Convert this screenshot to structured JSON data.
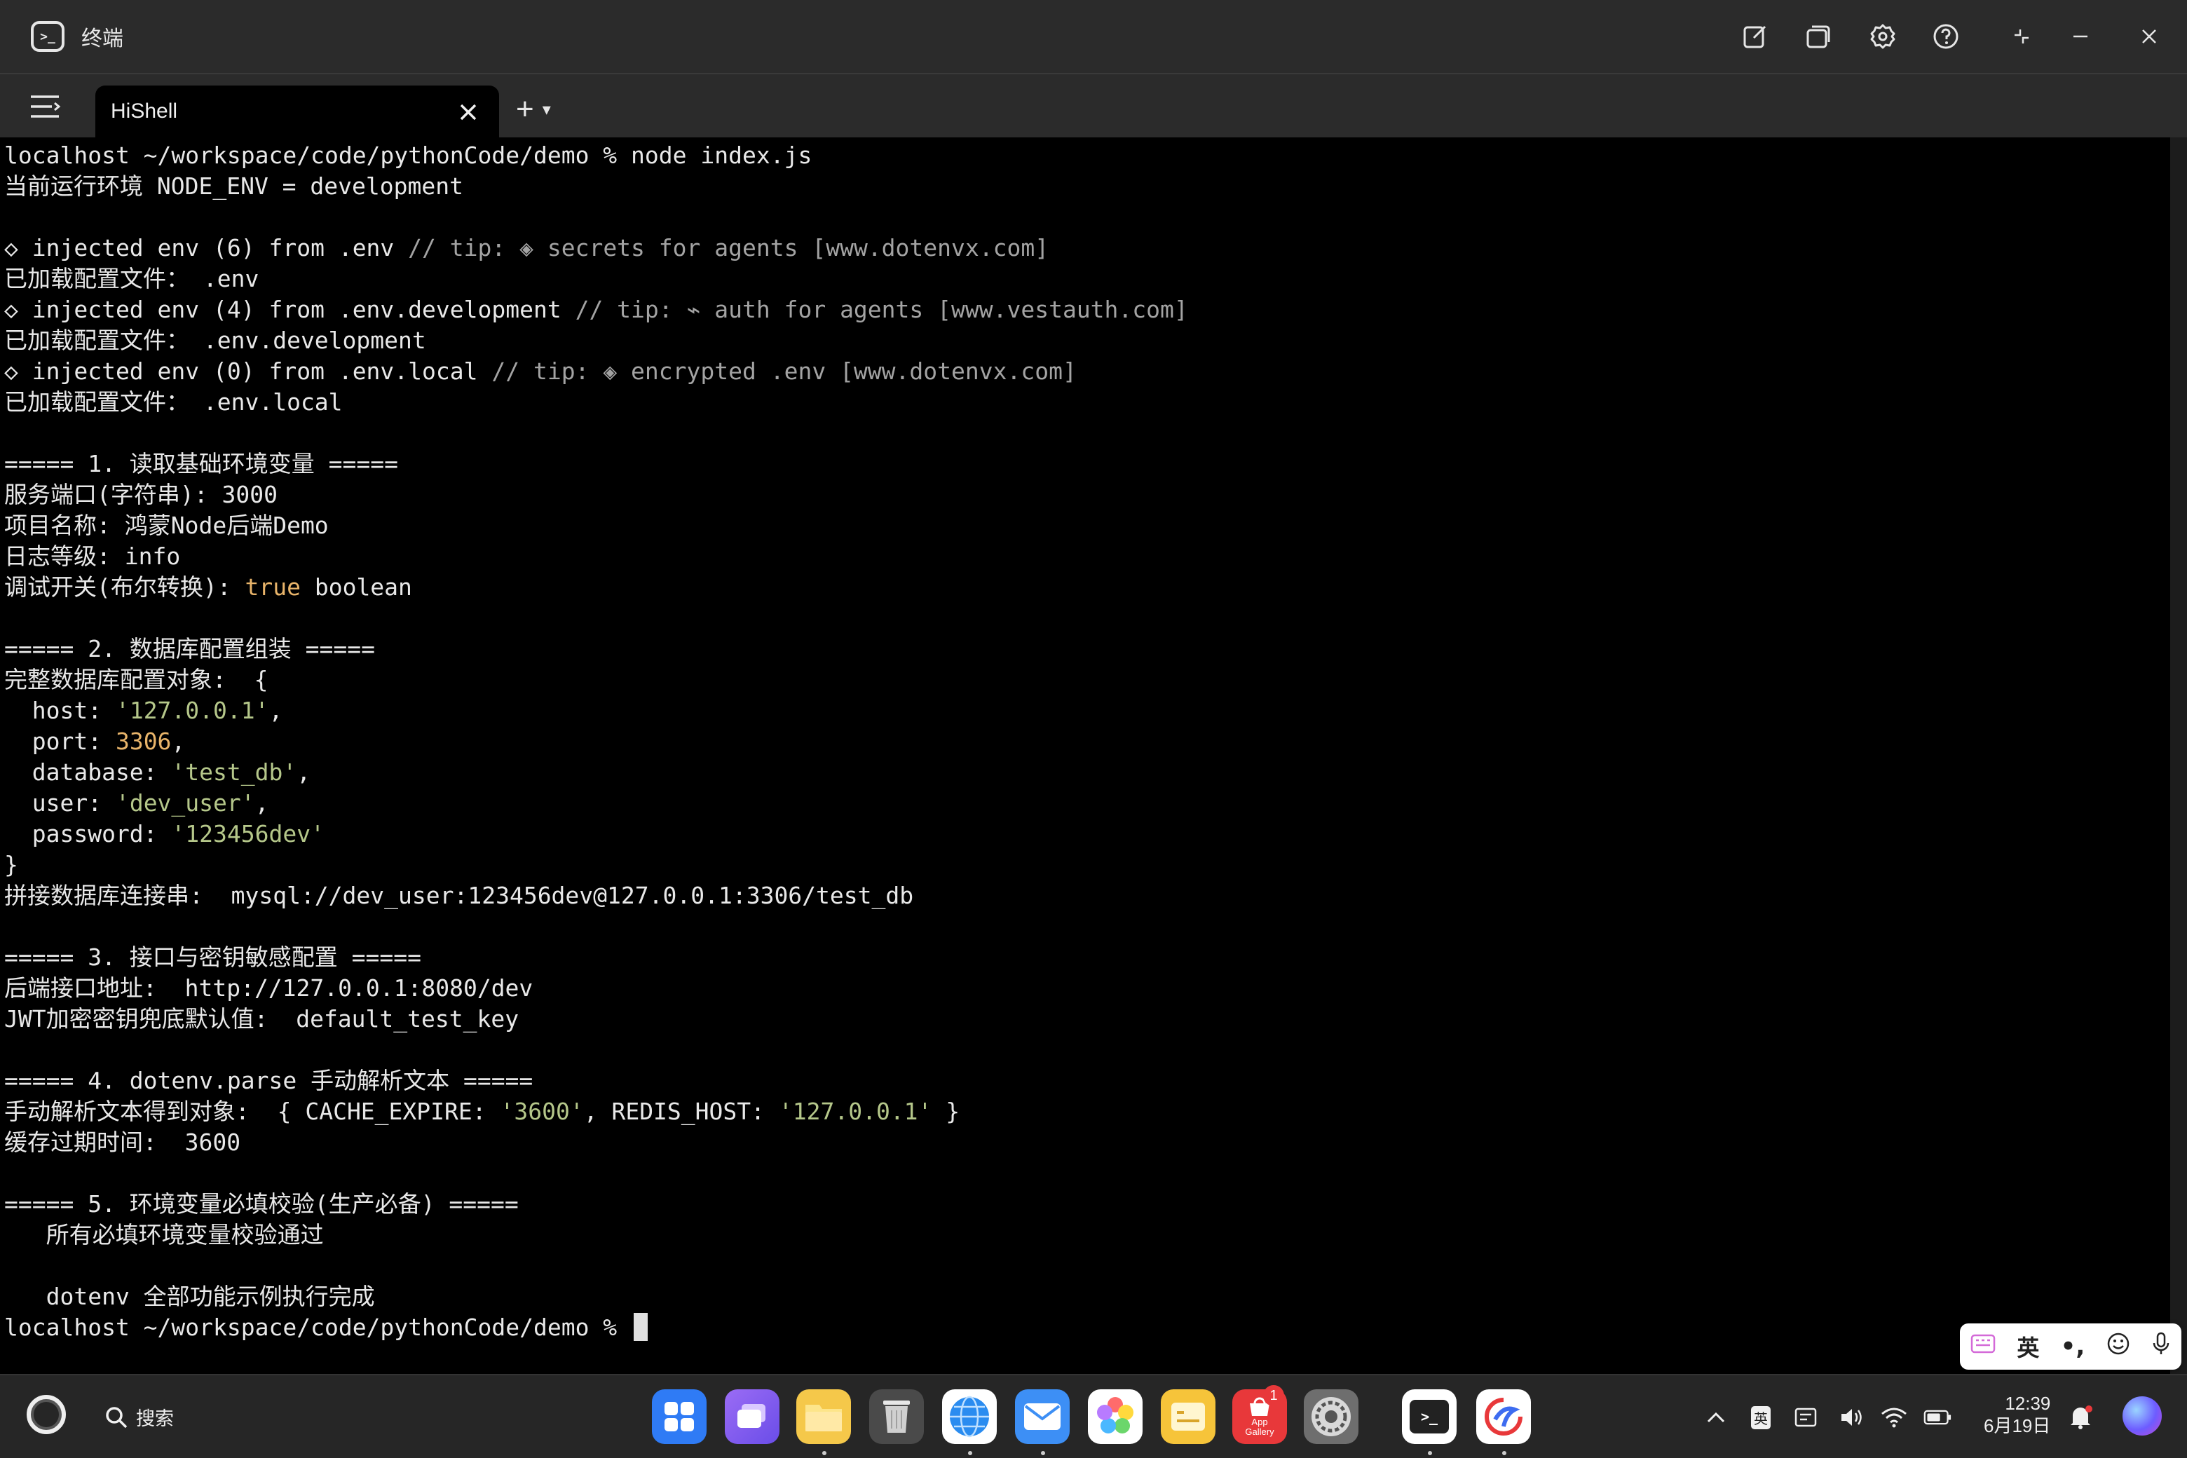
{
  "window": {
    "title": "终端",
    "controls": [
      "new-window",
      "multi-window",
      "settings",
      "help",
      "restore",
      "minimize",
      "close"
    ]
  },
  "tabbar": {
    "active_tab": "HiShell",
    "new_tab": "+",
    "new_tab_menu": "▾"
  },
  "colors": {
    "background": "#000000",
    "text": "#e8e8e8",
    "comment": "#a3a3a3",
    "string": "#b5c78a",
    "number": "#e8b46a",
    "chrome": "#2b2b2b"
  },
  "terminal": {
    "lines": [
      {
        "segments": [
          {
            "t": "localhost ~/workspace/code/pythonCode/demo % node index.js",
            "c": ""
          }
        ]
      },
      {
        "segments": [
          {
            "t": "当前运行环境 NODE_ENV = development",
            "c": ""
          }
        ]
      },
      {
        "segments": []
      },
      {
        "segments": [
          {
            "t": "◇ injected env (6) from .env ",
            "c": ""
          },
          {
            "t": "// tip: ◈ secrets for agents [www.dotenvx.com]",
            "c": "gray"
          }
        ]
      },
      {
        "segments": [
          {
            "t": "已加载配置文件： .env",
            "c": ""
          }
        ]
      },
      {
        "segments": [
          {
            "t": "◇ injected env (4) from .env.development ",
            "c": ""
          },
          {
            "t": "// tip: ⌁ auth for agents [www.vestauth.com]",
            "c": "gray"
          }
        ]
      },
      {
        "segments": [
          {
            "t": "已加载配置文件： .env.development",
            "c": ""
          }
        ]
      },
      {
        "segments": [
          {
            "t": "◇ injected env (0) from .env.local ",
            "c": ""
          },
          {
            "t": "// tip: ◈ encrypted .env [www.dotenvx.com]",
            "c": "gray"
          }
        ]
      },
      {
        "segments": [
          {
            "t": "已加载配置文件： .env.local",
            "c": ""
          }
        ]
      },
      {
        "segments": []
      },
      {
        "segments": [
          {
            "t": "===== 1. 读取基础环境变量 =====",
            "c": ""
          }
        ]
      },
      {
        "segments": [
          {
            "t": "服务端口(字符串): 3000",
            "c": ""
          }
        ]
      },
      {
        "segments": [
          {
            "t": "项目名称: 鸿蒙Node后端Demo",
            "c": ""
          }
        ]
      },
      {
        "segments": [
          {
            "t": "日志等级: info",
            "c": ""
          }
        ]
      },
      {
        "segments": [
          {
            "t": "调试开关(布尔转换): ",
            "c": ""
          },
          {
            "t": "true",
            "c": "orange"
          },
          {
            "t": " boolean",
            "c": ""
          }
        ]
      },
      {
        "segments": []
      },
      {
        "segments": [
          {
            "t": "===== 2. 数据库配置组装 =====",
            "c": ""
          }
        ]
      },
      {
        "segments": [
          {
            "t": "完整数据库配置对象:  {",
            "c": ""
          }
        ]
      },
      {
        "segments": [
          {
            "t": "  host: ",
            "c": ""
          },
          {
            "t": "'127.0.0.1'",
            "c": "green"
          },
          {
            "t": ",",
            "c": ""
          }
        ]
      },
      {
        "segments": [
          {
            "t": "  port: ",
            "c": ""
          },
          {
            "t": "3306",
            "c": "orange"
          },
          {
            "t": ",",
            "c": ""
          }
        ]
      },
      {
        "segments": [
          {
            "t": "  database: ",
            "c": ""
          },
          {
            "t": "'test_db'",
            "c": "green"
          },
          {
            "t": ",",
            "c": ""
          }
        ]
      },
      {
        "segments": [
          {
            "t": "  user: ",
            "c": ""
          },
          {
            "t": "'dev_user'",
            "c": "green"
          },
          {
            "t": ",",
            "c": ""
          }
        ]
      },
      {
        "segments": [
          {
            "t": "  password: ",
            "c": ""
          },
          {
            "t": "'123456dev'",
            "c": "green"
          }
        ]
      },
      {
        "segments": [
          {
            "t": "}",
            "c": ""
          }
        ]
      },
      {
        "segments": [
          {
            "t": "拼接数据库连接串:  mysql://dev_user:123456dev@127.0.0.1:3306/test_db",
            "c": ""
          }
        ]
      },
      {
        "segments": []
      },
      {
        "segments": [
          {
            "t": "===== 3. 接口与密钥敏感配置 =====",
            "c": ""
          }
        ]
      },
      {
        "segments": [
          {
            "t": "后端接口地址:  http://127.0.0.1:8080/dev",
            "c": ""
          }
        ]
      },
      {
        "segments": [
          {
            "t": "JWT加密密钥兜底默认值:  default_test_key",
            "c": ""
          }
        ]
      },
      {
        "segments": []
      },
      {
        "segments": [
          {
            "t": "===== 4. dotenv.parse 手动解析文本 =====",
            "c": ""
          }
        ]
      },
      {
        "segments": [
          {
            "t": "手动解析文本得到对象:  { CACHE_EXPIRE: ",
            "c": ""
          },
          {
            "t": "'3600'",
            "c": "green"
          },
          {
            "t": ", REDIS_HOST: ",
            "c": ""
          },
          {
            "t": "'127.0.0.1'",
            "c": "green"
          },
          {
            "t": " }",
            "c": ""
          }
        ]
      },
      {
        "segments": [
          {
            "t": "缓存过期时间:  3600",
            "c": ""
          }
        ]
      },
      {
        "segments": []
      },
      {
        "segments": [
          {
            "t": "===== 5. 环境变量必填校验(生产必备) =====",
            "c": ""
          }
        ]
      },
      {
        "segments": [
          {
            "t": "   所有必填环境变量校验通过",
            "c": ""
          }
        ]
      },
      {
        "segments": []
      },
      {
        "segments": [
          {
            "t": "   dotenv 全部功能示例执行完成",
            "c": ""
          }
        ]
      },
      {
        "segments": [
          {
            "t": "localhost ~/workspace/code/pythonCode/demo % ",
            "c": ""
          }
        ],
        "cursor": true
      }
    ]
  },
  "ime": {
    "mode": "英",
    "items": [
      "keyboard-icon",
      "英",
      "punctuation-icon",
      "emoji-icon",
      "mic-icon"
    ]
  },
  "taskbar": {
    "search_label": "搜索",
    "apps": [
      {
        "name": "app-center",
        "bg": "#2f7bf5",
        "running": false
      },
      {
        "name": "multi-screen",
        "bg": "#8a5cf0",
        "running": false
      },
      {
        "name": "files",
        "bg": "#f5c84a",
        "running": true
      },
      {
        "name": "recycle-bin",
        "bg": "#d8d8d8",
        "running": false
      },
      {
        "name": "browser",
        "bg": "#2a8cf0",
        "running": true
      },
      {
        "name": "mail",
        "bg": "#3d8ff5",
        "running": true
      },
      {
        "name": "gallery",
        "bg": "#ffffff",
        "running": false
      },
      {
        "name": "notes",
        "bg": "#f6c43a",
        "running": false
      },
      {
        "name": "app-gallery",
        "bg": "#e8383a",
        "running": false
      },
      {
        "name": "system-settings",
        "bg": "#7a7a7a",
        "running": false
      },
      {
        "name": "terminal",
        "bg": "#ffffff",
        "running": true
      },
      {
        "name": "code-editor",
        "bg": "#ffffff",
        "running": true
      }
    ],
    "app_gallery_label": "App Gallery",
    "app_gallery_badge": "1",
    "tray": {
      "ime_indicator": "英",
      "time": "12:39",
      "date": "6月19日"
    }
  }
}
